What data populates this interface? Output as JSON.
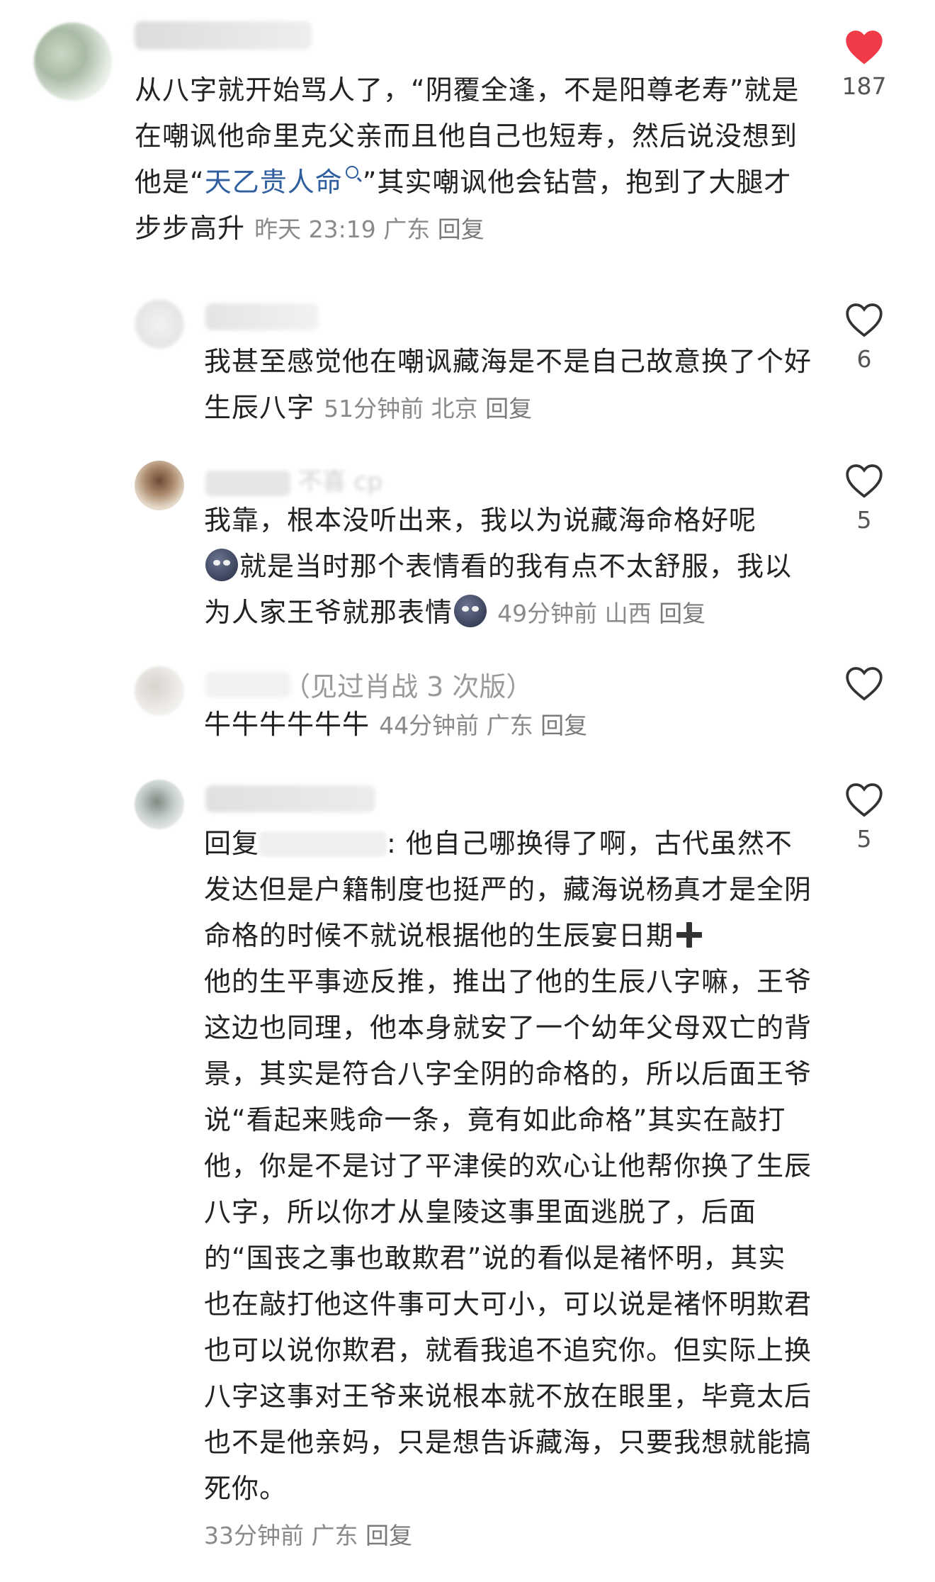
{
  "comments": [
    {
      "name": "",
      "text_before_link": "从八字就开始骂人了，“阴覆全逢，不是阳尊老寿”就是在嘲讽他命里克父亲而且他自己也短寿，然后说没想到他是“",
      "link": "天乙贵人命",
      "text_after_link": "”其实嘲讽他会钻营，抱到了大腿才步步高升",
      "time": "昨天 23:19",
      "location": "广东",
      "reply": "回复",
      "likes": "187",
      "liked": true
    },
    {
      "name": "",
      "text": "我甚至感觉他在嘲讽藏海是不是自己故意换了个好生辰八字",
      "time": "51分钟前",
      "location": "北京",
      "reply": "回复",
      "likes": "6"
    },
    {
      "name": "",
      "name_visible": "不喜 cp",
      "text_part1": "我靠，根本没听出来，我以为说藏海命格好呢",
      "text_part2": "就是当时那个表情看的我有点不太舒服，我以为人家王爷就那表情",
      "time": "49分钟前",
      "location": "山西",
      "reply": "回复",
      "likes": "5"
    },
    {
      "name_suffix": "（见过肖战 3 次版）",
      "text": "牛牛牛牛牛牛",
      "time": "44分钟前",
      "location": "广东",
      "reply": "回复",
      "likes": ""
    },
    {
      "reply_prefix": "回复",
      "text_part1": ": 他自己哪换得了啊，古代虽然不发达但是户籍制度也挺严的，藏海说杨真才是全阴命格的时候不就说根据他的生辰宴日期",
      "text_part2": "他的生平事迹反推，推出了他的生辰八字嘛，王爷这边也同理，他本身就安了一个幼年父母双亡的背景，其实是符合八字全阴的命格的，所以后面王爷说“看起来贱命一条，竟有如此命格”其实在敲打他，你是不是讨了平津侯的欢心让他帮你换了生辰八字，所以你才从皇陵这事里面逃脱了，后面的“国丧之事也敢欺君”说的看似是褚怀明，其实也在敲打他这件事可大可小，可以说是褚怀明欺君也可以说你欺君，就看我追不追究你。但实际上换八字这事对王爷来说根本就不放在眼里，毕竟太后也不是他亲妈，只是想告诉藏海，只要我想就能搞死你。",
      "time": "33分钟前",
      "location": "广东",
      "reply": "回复",
      "likes": "5"
    }
  ],
  "colors": {
    "accent_like": "#f03a48",
    "link": "#2f5f9e",
    "meta": "#8a8a8a"
  }
}
